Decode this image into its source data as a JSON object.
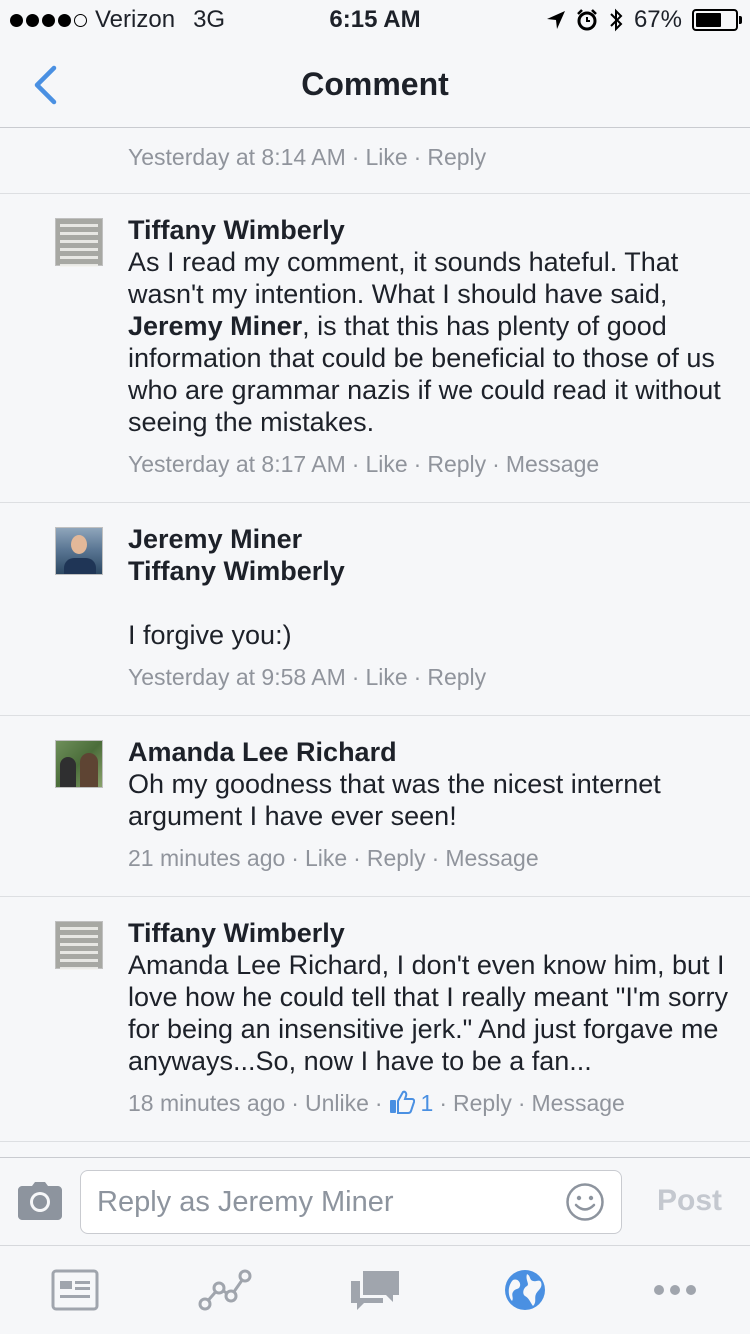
{
  "status_bar": {
    "carrier": "Verizon",
    "network": "3G",
    "time": "6:15 AM",
    "battery": "67%",
    "battery_level": 0.67,
    "signal_bars": 4
  },
  "nav": {
    "title": "Comment",
    "back_icon": "chevron-left-icon"
  },
  "comments": [
    {
      "timestamp": "Yesterday at 8:14 AM",
      "like": "Like",
      "reply": "Reply"
    },
    {
      "author": "Tiffany Wimberly",
      "text_before": "As I read my comment, it sounds hateful. That wasn't my intention. What I should have said, ",
      "mention": "Jeremy Miner",
      "text_after": ", is that this has plenty of good information that could be beneficial to those of us who are grammar nazis if we could read it without seeing the mistakes.",
      "timestamp": "Yesterday at 8:17 AM",
      "like": "Like",
      "reply": "Reply",
      "message": "Message"
    },
    {
      "author": "Jeremy Miner",
      "mention": "Tiffany Wimberly",
      "text": "I forgive you:)",
      "timestamp": "Yesterday at 9:58 AM",
      "like": "Like",
      "reply": "Reply"
    },
    {
      "author": "Amanda Lee Richard",
      "text": "Oh my goodness that was the nicest internet argument I have ever seen!",
      "timestamp": "21 minutes ago",
      "like": "Like",
      "reply": "Reply",
      "message": "Message"
    },
    {
      "author": "Tiffany Wimberly",
      "text": "Amanda Lee Richard, I don't even know him, but I love how he could tell that I really meant \"I'm sorry for being an insensitive jerk.\" And just forgave me anyways...So, now I have to be a fan...",
      "timestamp": "18 minutes ago",
      "unlike": "Unlike",
      "like_count": "1",
      "reply": "Reply",
      "message": "Message"
    }
  ],
  "reply_bar": {
    "placeholder": "Reply as Jeremy Miner",
    "post_label": "Post"
  },
  "tab_bar": {
    "tabs": [
      "news-feed-icon",
      "activity-graph-icon",
      "messages-icon",
      "globe-notifications-icon",
      "more-icon"
    ],
    "active_tab": "globe-notifications-icon"
  },
  "colors": {
    "accent": "#4a90e2",
    "secondary_text": "#90949c",
    "background": "#f6f7f9"
  }
}
